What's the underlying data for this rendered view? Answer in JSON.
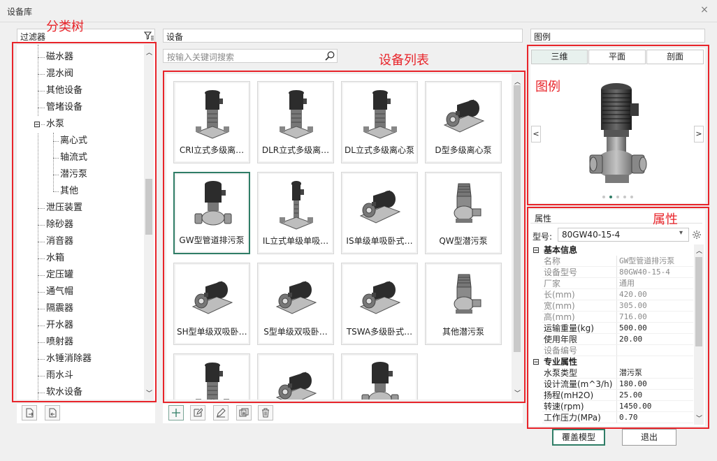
{
  "window": {
    "title": "设备库",
    "close_glyph": "×"
  },
  "annotations": {
    "tree": "分类树",
    "list": "设备列表",
    "legend": "图例",
    "props": "属性"
  },
  "filter": {
    "label": "过滤器"
  },
  "tree": {
    "items": [
      {
        "label": "磁水器",
        "level": 0
      },
      {
        "label": "混水阀",
        "level": 0
      },
      {
        "label": "其他设备",
        "level": 0
      },
      {
        "label": "管堵设备",
        "level": 0
      },
      {
        "label": "水泵",
        "level": 0,
        "expanded": true,
        "toggle": "⊟"
      },
      {
        "label": "离心式",
        "level": 1
      },
      {
        "label": "轴流式",
        "level": 1
      },
      {
        "label": "潜污泵",
        "level": 1
      },
      {
        "label": "其他",
        "level": 1
      },
      {
        "label": "泄压装置",
        "level": 0
      },
      {
        "label": "除砂器",
        "level": 0
      },
      {
        "label": "消音器",
        "level": 0
      },
      {
        "label": "水箱",
        "level": 0
      },
      {
        "label": "定压罐",
        "level": 0
      },
      {
        "label": "通气帽",
        "level": 0
      },
      {
        "label": "隔震器",
        "level": 0
      },
      {
        "label": "开水器",
        "level": 0
      },
      {
        "label": "喷射器",
        "level": 0
      },
      {
        "label": "水锤消除器",
        "level": 0
      },
      {
        "label": "雨水斗",
        "level": 0
      },
      {
        "label": "软水设备",
        "level": 0
      }
    ]
  },
  "devices": {
    "header": "设备",
    "search_placeholder": "按输入关键词搜索",
    "cards": [
      {
        "label": "CRI立式多级离…",
        "kind": "vertical"
      },
      {
        "label": "DLR立式多级离…",
        "kind": "vertical"
      },
      {
        "label": "DL立式多级离心泵",
        "kind": "vertical"
      },
      {
        "label": "D型多级离心泵",
        "kind": "horizontal"
      },
      {
        "label": "GW型管道排污泵",
        "kind": "pipeline",
        "selected": true
      },
      {
        "label": "IL立式单级单吸…",
        "kind": "tall"
      },
      {
        "label": "IS单级单吸卧式…",
        "kind": "horizontal"
      },
      {
        "label": "QW型潜污泵",
        "kind": "submersible"
      },
      {
        "label": "SH型单级双吸卧…",
        "kind": "horizontal"
      },
      {
        "label": "S型单级双吸卧…",
        "kind": "horizontal"
      },
      {
        "label": "TSWA多级卧式…",
        "kind": "horizontal"
      },
      {
        "label": "其他潜污泵",
        "kind": "submersible"
      },
      {
        "label": "",
        "kind": "vertical"
      },
      {
        "label": "",
        "kind": "horizontal"
      },
      {
        "label": "",
        "kind": "pipeline"
      }
    ]
  },
  "legend": {
    "header": "图例",
    "tabs": [
      "三维",
      "平面",
      "剖面"
    ],
    "active_tab": 0,
    "prev": "<",
    "next": ">",
    "page_count": 5,
    "page_active": 1
  },
  "properties": {
    "header": "属性",
    "model_label": "型号:",
    "model_value": "80GW40-15-4",
    "sections": [
      {
        "title": "基本信息",
        "toggle": "⊟",
        "rows": [
          {
            "k": "名称",
            "v": "GW型管道排污泵",
            "ro": true
          },
          {
            "k": "设备型号",
            "v": "80GW40-15-4",
            "ro": true
          },
          {
            "k": "厂家",
            "v": "通用",
            "ro": true
          },
          {
            "k": "长(mm)",
            "v": "420.00",
            "ro": true
          },
          {
            "k": "宽(mm)",
            "v": "305.00",
            "ro": true
          },
          {
            "k": "高(mm)",
            "v": "716.00",
            "ro": true
          },
          {
            "k": "运输重量(kg)",
            "v": "500.00",
            "ro": false
          },
          {
            "k": "使用年限",
            "v": "20.00",
            "ro": false
          },
          {
            "k": "设备编号",
            "v": "",
            "ro": true
          }
        ]
      },
      {
        "title": "专业属性",
        "toggle": "⊟",
        "rows": [
          {
            "k": "水泵类型",
            "v": "潜污泵",
            "ro": false
          },
          {
            "k": "设计流量(m^3/h)",
            "v": "180.00",
            "ro": false
          },
          {
            "k": "扬程(mH2O)",
            "v": "25.00",
            "ro": false
          },
          {
            "k": "转速(rpm)",
            "v": "1450.00",
            "ro": false
          },
          {
            "k": "工作压力(MPa)",
            "v": "0.70",
            "ro": false
          }
        ]
      }
    ]
  },
  "buttons": {
    "override": "覆盖模型",
    "exit": "退出"
  },
  "colors": {
    "annotation_red": "#e8242a",
    "accent_green": "#2f7d66"
  }
}
